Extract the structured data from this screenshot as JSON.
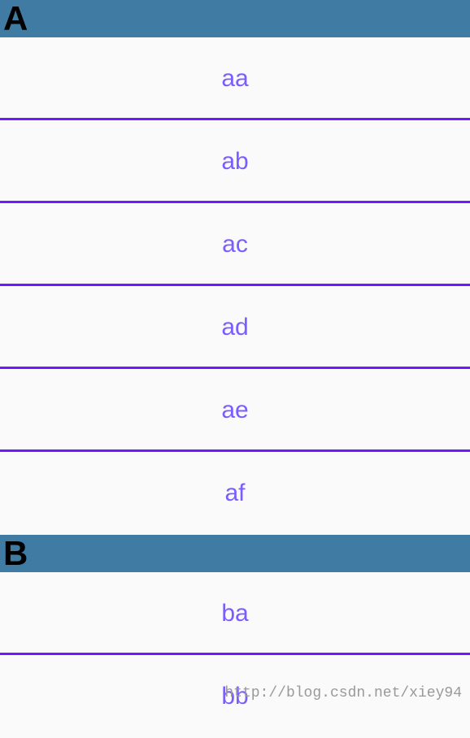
{
  "sections": [
    {
      "header": "A",
      "items": [
        "aa",
        "ab",
        "ac",
        "ad",
        "ae",
        "af"
      ]
    },
    {
      "header": "B",
      "items": [
        "ba",
        "bb"
      ]
    }
  ],
  "watermark": "http://blog.csdn.net/xiey94"
}
